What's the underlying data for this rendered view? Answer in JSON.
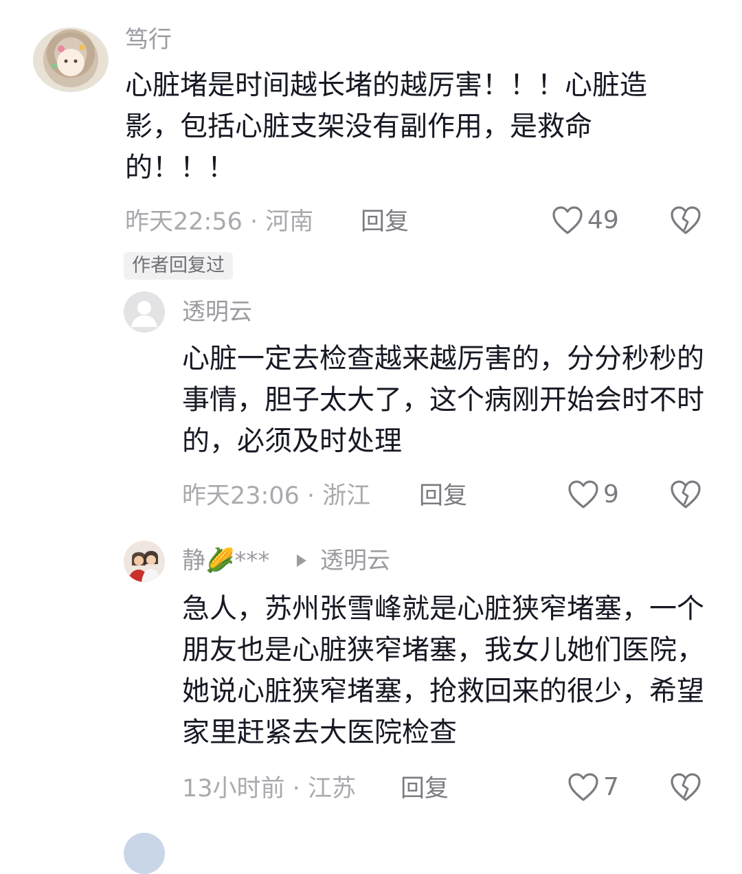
{
  "comments": [
    {
      "username": "笃行",
      "text": "心脏堵是时间越长堵的越厉害！！！心脏造影，包括心脏支架没有副作用，是救命的！！！",
      "time": "昨天22:56",
      "location": "河南",
      "reply_label": "回复",
      "likes": "49",
      "badge": "作者回复过"
    },
    {
      "username": "透明云",
      "text": "心脏一定去检查越来越厉害的，分分秒秒的事情，胆子太大了，这个病刚开始会时不时的，必须及时处理",
      "time": "昨天23:06",
      "location": "浙江",
      "reply_label": "回复",
      "likes": "9"
    },
    {
      "username": "静🌽***",
      "reply_to": "透明云",
      "text": "急人，苏州张雪峰就是心脏狭窄堵塞，一个朋友也是心脏狭窄堵塞，我女儿她们医院，她说心脏狭窄堵塞，抢救回来的很少，希望家里赶紧去大医院检查",
      "time": "13小时前",
      "location": "江苏",
      "reply_label": "回复",
      "likes": "7"
    }
  ],
  "separator": " · ",
  "icons": {
    "like": "heart-outline-icon",
    "dislike": "broken-heart-icon",
    "reply_arrow": "play-triangle-icon"
  },
  "colors": {
    "text": "#161823",
    "meta": "#a9a9ae",
    "badge_bg": "#f1f1f2"
  }
}
